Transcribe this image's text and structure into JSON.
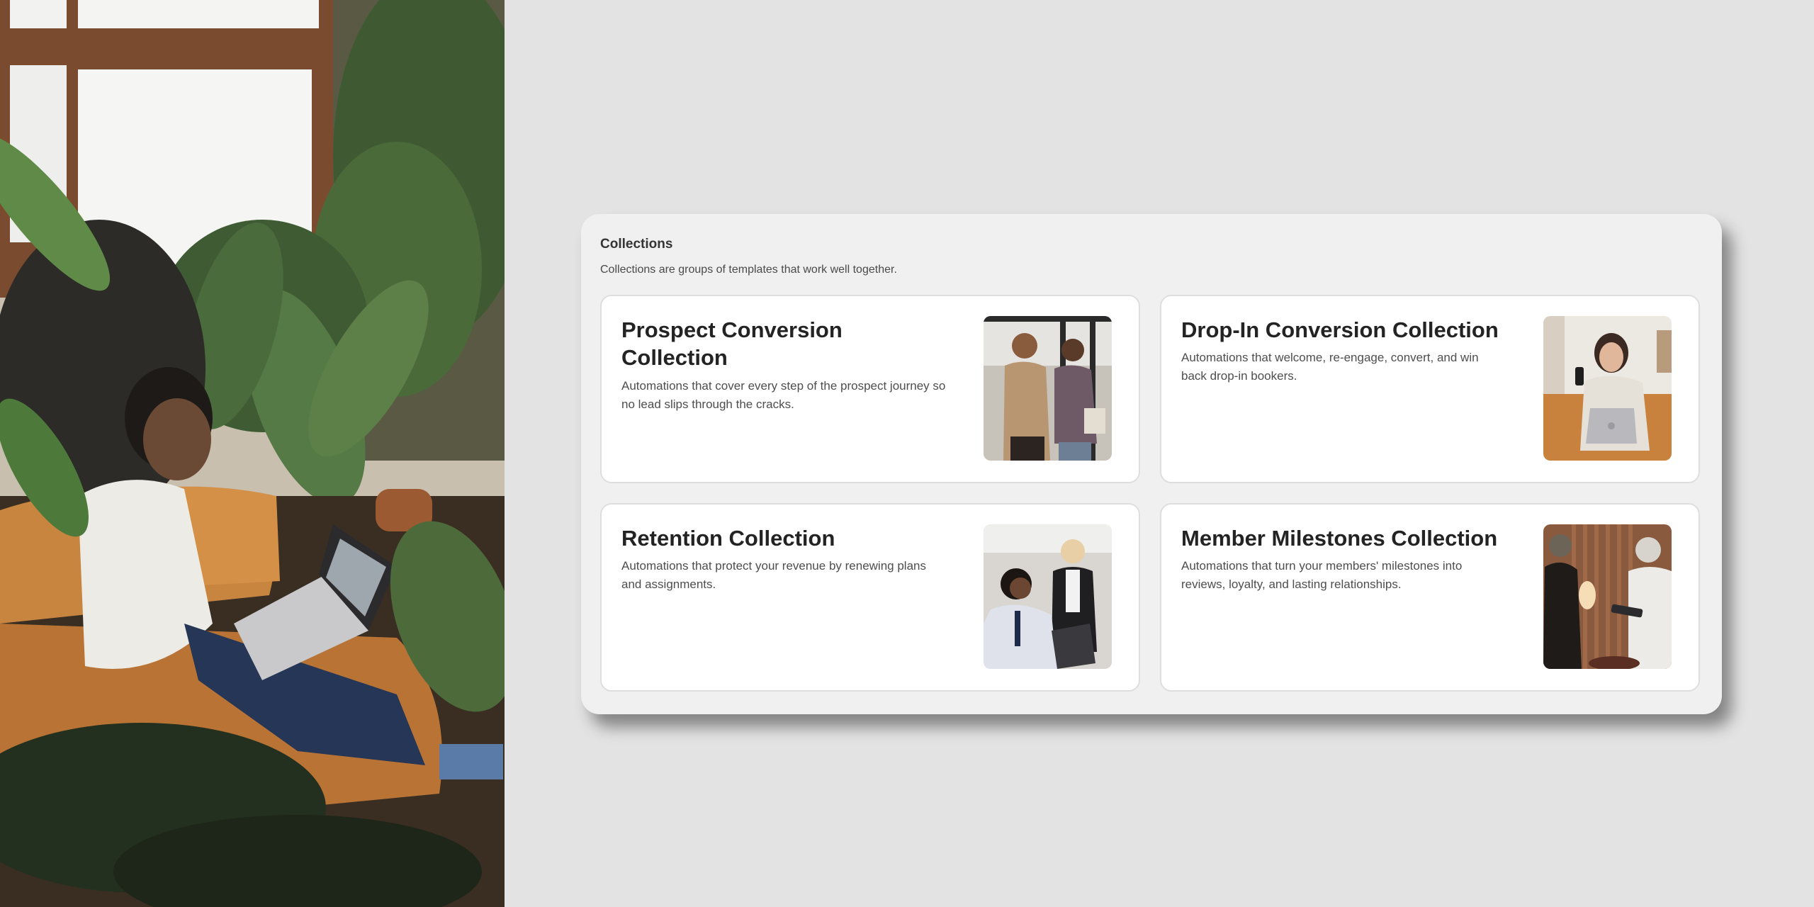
{
  "collections": {
    "title": "Collections",
    "subtitle": "Collections are groups of templates that work well together.",
    "cards": [
      {
        "title": "Prospect Conversion Collection",
        "description": "Automations that cover every step of the prospect journey so no lead slips through the cracks.",
        "image": "two-people-talking-photo"
      },
      {
        "title": "Drop-In Conversion Collection",
        "description": "Automations that welcome, re-engage, convert, and win back drop-in bookers.",
        "image": "woman-with-laptop-and-phone-photo"
      },
      {
        "title": "Retention Collection",
        "description": "Automations that protect your revenue by renewing plans and assignments.",
        "image": "office-colleagues-at-laptop-photo"
      },
      {
        "title": "Member Milestones Collection",
        "description": "Automations that turn your members' milestones into reviews, loyalty, and lasting relationships.",
        "image": "handing-tablet-to-member-photo"
      }
    ]
  },
  "colors": {
    "page_background": "#e3e3e3",
    "panel_background": "#f0f0f0",
    "card_background": "#ffffff",
    "card_border": "#dedede"
  }
}
